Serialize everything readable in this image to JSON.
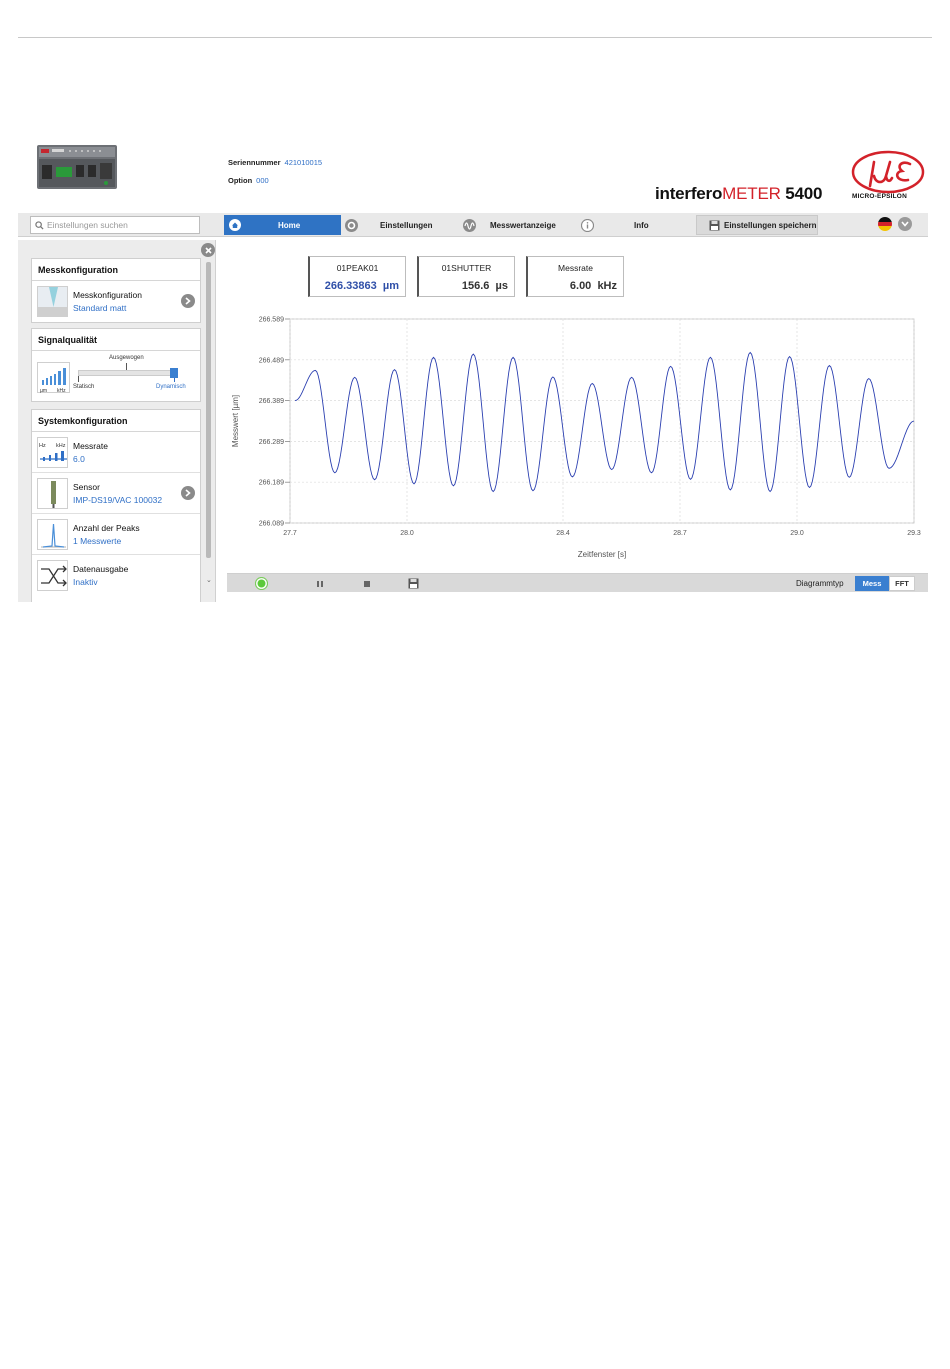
{
  "header": {
    "serial_label": "Seriennummer",
    "serial_value": "421010015",
    "option_label": "Option",
    "option_value": "000",
    "product_part1": "interfero",
    "product_part2": "METER",
    "product_part3": " 5400",
    "brand_name": "MICRO-EPSILON"
  },
  "nav": {
    "search_placeholder": "Einstellungen suchen",
    "home": "Home",
    "settings": "Einstellungen",
    "values": "Messwertanzeige",
    "info": "Info",
    "save": "Einstellungen speichern"
  },
  "sidebar": {
    "measurement_config": {
      "title": "Messkonfiguration",
      "items": [
        {
          "label": "Messkonfiguration",
          "value": "Standard matt"
        }
      ]
    },
    "signal_quality": {
      "title": "Signalqualität",
      "mid": "Ausgewogen",
      "left": "Statisch",
      "right": "Dynamisch",
      "thumb_left": "µm",
      "thumb_right": "kHz",
      "level": 1.0
    },
    "system_config": {
      "title": "Systemkonfiguration",
      "items": [
        {
          "label": "Messrate",
          "value": "6.0",
          "thumb_left": "Hz",
          "thumb_right": "kHz"
        },
        {
          "label": "Sensor",
          "value": "IMP-DS19/VAC 100032"
        },
        {
          "label": "Anzahl der Peaks",
          "value": "1 Messwerte"
        },
        {
          "label": "Datenausgabe",
          "value": "Inaktiv"
        }
      ]
    }
  },
  "values": [
    {
      "title": "01PEAK01",
      "value": "266.33863",
      "unit": "µm"
    },
    {
      "title": "01SHUTTER",
      "value": "156.6",
      "unit": "µs"
    },
    {
      "title": "Messrate",
      "value": "6.00",
      "unit": "kHz"
    }
  ],
  "chart_data": {
    "type": "line",
    "xlabel": "Zeitfenster [s]",
    "ylabel": "Messwert [µm]",
    "xlim": [
      27.7,
      29.3
    ],
    "ylim": [
      266.089,
      266.589
    ],
    "xticks": [
      "27.7",
      "28.0",
      "28.4",
      "28.7",
      "29.0",
      "29.3"
    ],
    "yticks": [
      "266.589",
      "266.489",
      "266.389",
      "266.289",
      "266.189",
      "266.089"
    ],
    "grid": true,
    "color": "#2b3fb0",
    "series": [
      {
        "peaks": [
          [
            27.765,
            266.463
          ],
          [
            27.866,
            266.446
          ],
          [
            27.968,
            266.465
          ],
          [
            28.068,
            266.495
          ],
          [
            28.17,
            266.503
          ],
          [
            28.272,
            266.495
          ],
          [
            28.374,
            266.447
          ],
          [
            28.475,
            266.431
          ],
          [
            28.576,
            266.446
          ],
          [
            28.676,
            266.473
          ],
          [
            28.778,
            266.495
          ],
          [
            28.88,
            266.507
          ],
          [
            28.981,
            266.497
          ],
          [
            29.083,
            266.475
          ],
          [
            29.184,
            266.443
          ]
        ],
        "troughs": [
          [
            27.713,
            266.389
          ],
          [
            27.815,
            266.212
          ],
          [
            27.917,
            266.195
          ],
          [
            28.018,
            266.185
          ],
          [
            28.119,
            266.18
          ],
          [
            28.221,
            266.166
          ],
          [
            28.323,
            266.168
          ],
          [
            28.424,
            266.202
          ],
          [
            28.525,
            266.22
          ],
          [
            28.627,
            266.212
          ],
          [
            28.727,
            266.196
          ],
          [
            28.829,
            266.17
          ],
          [
            28.931,
            266.166
          ],
          [
            29.032,
            266.176
          ],
          [
            29.134,
            266.201
          ],
          [
            29.236,
            266.223
          ],
          [
            29.3,
            266.339
          ]
        ]
      }
    ]
  },
  "bottombar": {
    "diagram_label": "Diagrammtyp",
    "mess": "Mess",
    "fft": "FFT"
  },
  "colors": {
    "accent": "#2f73c4",
    "brand_red": "#d3222a",
    "link_blue": "#2f6fc6",
    "status_green": "#5cc93a"
  }
}
